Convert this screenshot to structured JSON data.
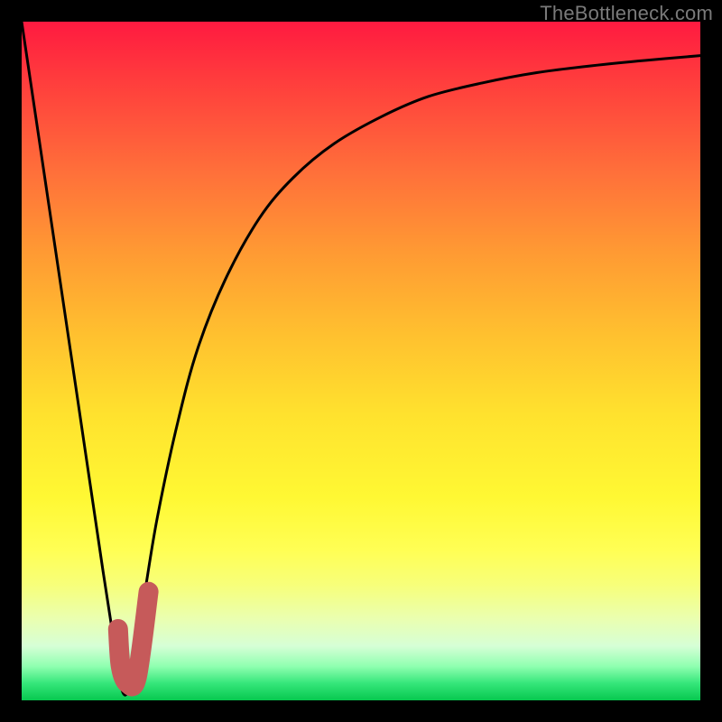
{
  "watermark": {
    "text": "TheBottleneck.com"
  },
  "colors": {
    "frame": "#000000",
    "curve": "#000000",
    "marker": "#c65a5a"
  },
  "chart_data": {
    "type": "line",
    "title": "",
    "xlabel": "",
    "ylabel": "",
    "x_range": [
      0,
      100
    ],
    "y_range": [
      0,
      100
    ],
    "series": [
      {
        "name": "bottleneck-curve",
        "x": [
          0,
          4,
          8,
          12,
          14,
          15,
          16,
          18,
          20,
          23,
          26,
          30,
          35,
          40,
          46,
          53,
          60,
          68,
          76,
          84,
          92,
          100
        ],
        "y": [
          100,
          73,
          46,
          19,
          6,
          1,
          3,
          15,
          27,
          41,
          52,
          62,
          71,
          77,
          82,
          86,
          89,
          91,
          92.5,
          93.5,
          94.3,
          95
        ]
      }
    ],
    "marker": {
      "name": "highlight-j",
      "points_xy": [
        [
          14.2,
          10.5
        ],
        [
          14.6,
          5.0
        ],
        [
          15.6,
          2.5
        ],
        [
          17.0,
          3.5
        ],
        [
          18.7,
          16.0
        ]
      ]
    }
  }
}
